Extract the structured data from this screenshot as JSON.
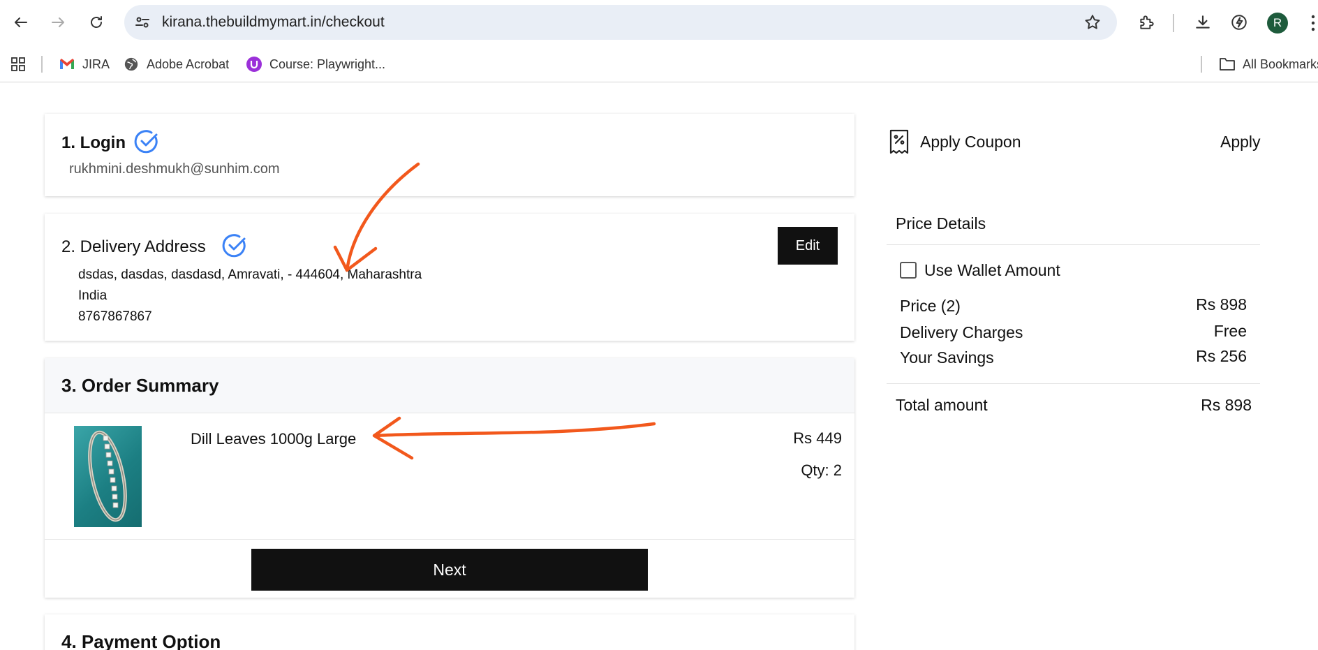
{
  "browser": {
    "url": "kirana.thebuildmymart.in/checkout",
    "avatar_letter": "R",
    "bookmarks": [
      {
        "label": "JIRA",
        "icon": "gmail-icon"
      },
      {
        "label": "Adobe Acrobat",
        "icon": "globe-icon"
      },
      {
        "label": "Course: Playwright...",
        "icon": "course-icon"
      }
    ],
    "all_bookmarks": "All Bookmarks"
  },
  "login": {
    "title": "1. Login",
    "email": "rukhmini.deshmukh@sunhim.com"
  },
  "delivery": {
    "title": "2. Delivery Address",
    "edit_label": "Edit",
    "address_line1": "dsdas, dasdas, dasdasd, Amravati, - 444604, Maharashtra",
    "address_line2": "India",
    "phone": "8767867867"
  },
  "order_summary": {
    "title": "3. Order Summary",
    "item": {
      "name": "Dill Leaves 1000g Large",
      "price": "Rs 449",
      "qty": "Qty: 2"
    },
    "next_label": "Next"
  },
  "payment": {
    "title": "4. Payment Option"
  },
  "coupon": {
    "label": "Apply Coupon",
    "apply_label": "Apply"
  },
  "price_details": {
    "title": "Price Details",
    "wallet_label": "Use Wallet Amount",
    "rows": [
      {
        "label": "Price (2)",
        "value": "Rs 898"
      },
      {
        "label": "Delivery Charges",
        "value": "Free"
      },
      {
        "label": "Your Savings",
        "value": "Rs 256"
      }
    ],
    "total_label": "Total amount",
    "total_value": "Rs 898"
  },
  "colors": {
    "accent_check": "#3b82f6",
    "annotation": "#f2581c",
    "button_dark": "#111111"
  }
}
